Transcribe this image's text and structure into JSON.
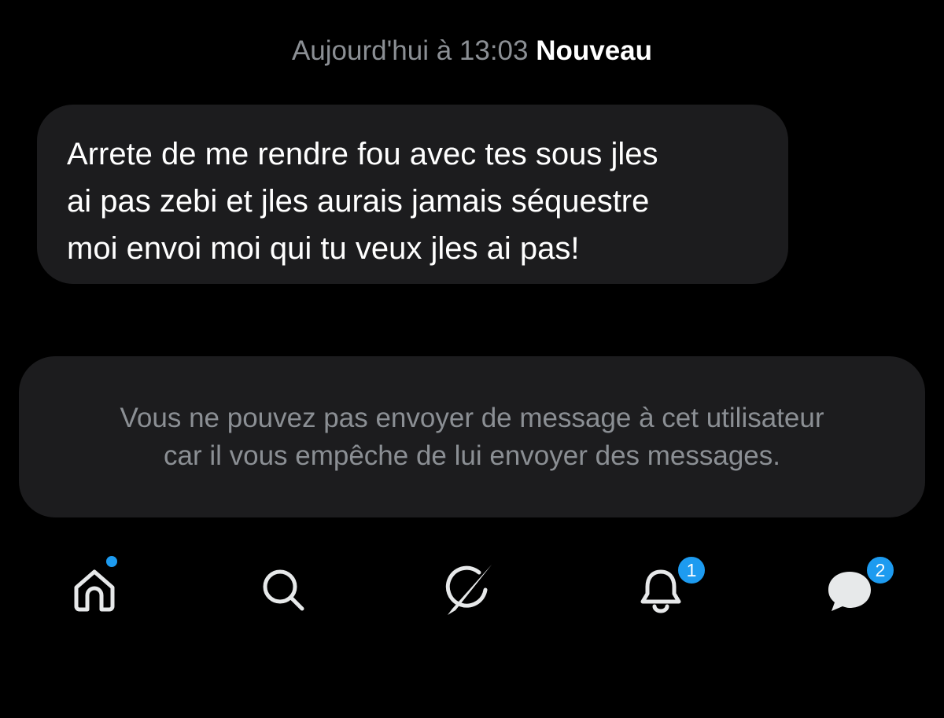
{
  "header": {
    "timestamp": "Aujourd'hui à 13:03",
    "new_label": "Nouveau"
  },
  "conversation": {
    "messages": [
      {
        "text": "Arrete de me rendre fou avec tes sous jles\nai pas zebi et jles aurais jamais séquestre\nmoi envoi moi qui tu veux jles ai pas!"
      }
    ]
  },
  "blocked_notice": {
    "text": "Vous ne pouvez pas envoyer de message à cet utilisateur\ncar il vous empêche de lui envoyer des messages."
  },
  "bottom_nav": {
    "items": [
      {
        "icon": "home-icon",
        "indicator": "dot"
      },
      {
        "icon": "search-icon"
      },
      {
        "icon": "grok-icon"
      },
      {
        "icon": "bell-icon",
        "badge": "1"
      },
      {
        "icon": "messages-icon",
        "badge": "2"
      }
    ]
  },
  "colors": {
    "background": "#000000",
    "bubble": "#1c1c1e",
    "text_primary": "#ffffff",
    "text_secondary": "#8b8f94",
    "accent": "#1d9bf0"
  }
}
